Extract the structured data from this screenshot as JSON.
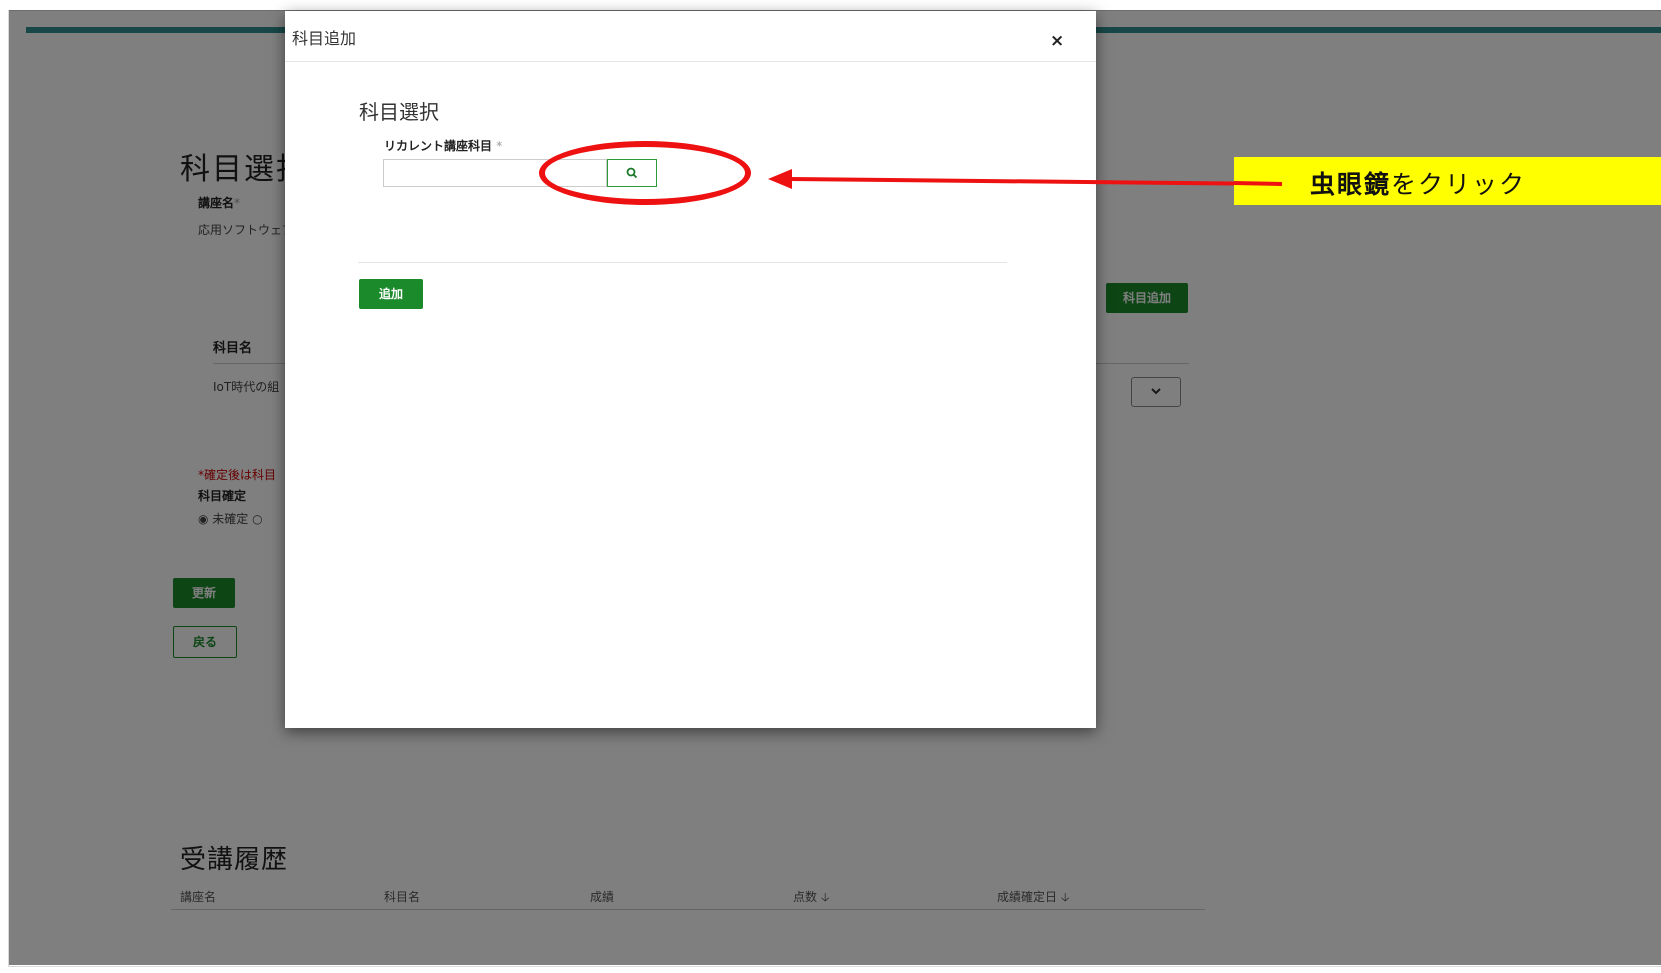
{
  "background": {
    "page_title": "科目選択",
    "course_label": "講座名",
    "required_mark": "*",
    "course_value": "応用ソフトウェア",
    "add_subject_button": "科目追加",
    "table_header_subject": "科目名",
    "table_row_subject": "IoT時代の組",
    "confirm_note": "*確定後は科目",
    "confirm_label": "科目確定",
    "radio_unconfirmed": "未確定",
    "update_button": "更新",
    "back_button": "戻る",
    "history_title": "受講履歴",
    "history_columns": [
      "講座名",
      "科目名",
      "成績",
      "点数",
      "成績確定日"
    ]
  },
  "modal": {
    "title": "科目追加",
    "close": "×",
    "heading": "科目選択",
    "field_label": "リカレント講座科目",
    "required_mark": "*",
    "input_value": "",
    "add_button": "追加"
  },
  "annotation": {
    "callout_bold": "虫眼鏡",
    "callout_rest": "をクリック",
    "highlight_color": "#ffff00",
    "marker_color": "#ee1111"
  }
}
